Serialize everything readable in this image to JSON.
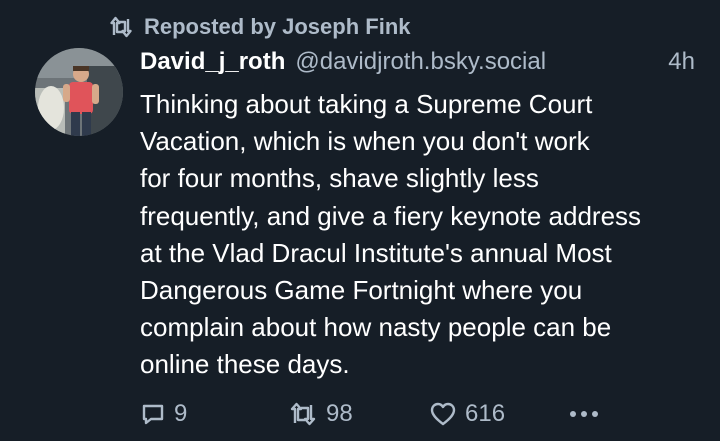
{
  "repost": {
    "label": "Reposted by Joseph Fink"
  },
  "post": {
    "author_name": "David_j_roth",
    "handle": "@davidjroth.bsky.social",
    "time": "4h",
    "text_lines": [
      "Thinking about taking a Supreme Court",
      "Vacation, which is when you don't work",
      "for four months, shave slightly less",
      "frequently, and give a fiery keynote address",
      "at the Vlad Dracul Institute's annual Most",
      "Dangerous Game Fortnight where you",
      "complain about how nasty people can be",
      "online these days."
    ]
  },
  "actions": {
    "reply_count": "9",
    "repost_count": "98",
    "like_count": "616"
  },
  "icons": {
    "repost": "repost-icon",
    "reply": "reply-icon",
    "like": "heart-icon",
    "more": "more-options-icon"
  },
  "colors": {
    "background": "#161e27",
    "text": "#ffffff",
    "muted": "#aebbc9"
  }
}
